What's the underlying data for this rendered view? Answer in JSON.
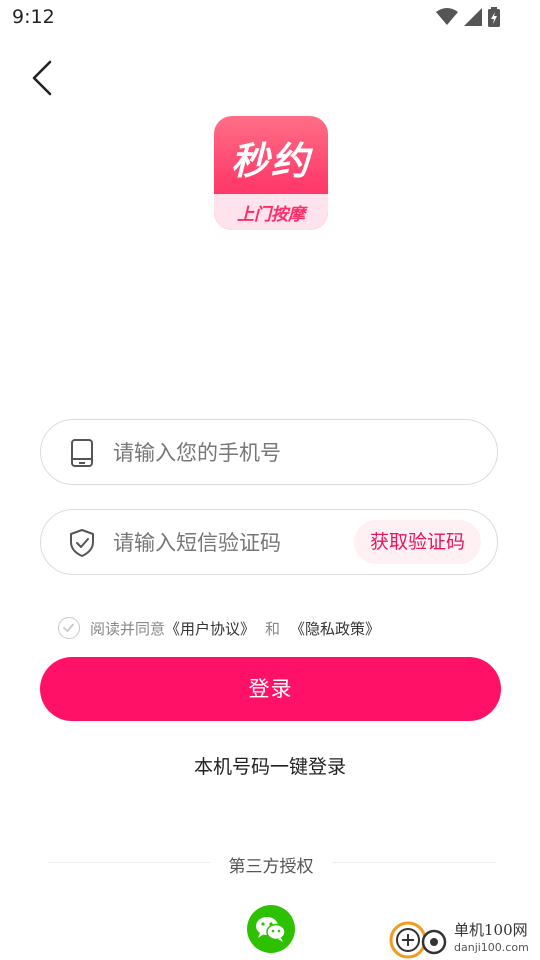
{
  "status_bar": {
    "time": "9:12"
  },
  "logo": {
    "title": "秒约",
    "subtitle": "上门按摩"
  },
  "phone_field": {
    "placeholder": "请输入您的手机号",
    "value": ""
  },
  "code_field": {
    "placeholder": "请输入短信验证码",
    "value": "",
    "get_code_label": "获取验证码"
  },
  "agreement": {
    "prefix": "阅读并同意",
    "user_agreement": "《用户协议》",
    "and": "和",
    "privacy_policy": "《隐私政策》",
    "checked": false
  },
  "login_button": {
    "label": "登录"
  },
  "one_key_login": {
    "label": "本机号码一键登录"
  },
  "third_party": {
    "label": "第三方授权"
  },
  "watermark": {
    "name": "单机100网",
    "site": "danji100.com"
  },
  "colors": {
    "accent": "#ff1167",
    "wechat": "#2dc100",
    "code_text": "#e8155f"
  },
  "icons": {
    "back": "chevron-left-icon",
    "phone": "phone-icon",
    "shield": "shield-check-icon",
    "check": "check-circle-icon",
    "wechat": "wechat-icon"
  }
}
